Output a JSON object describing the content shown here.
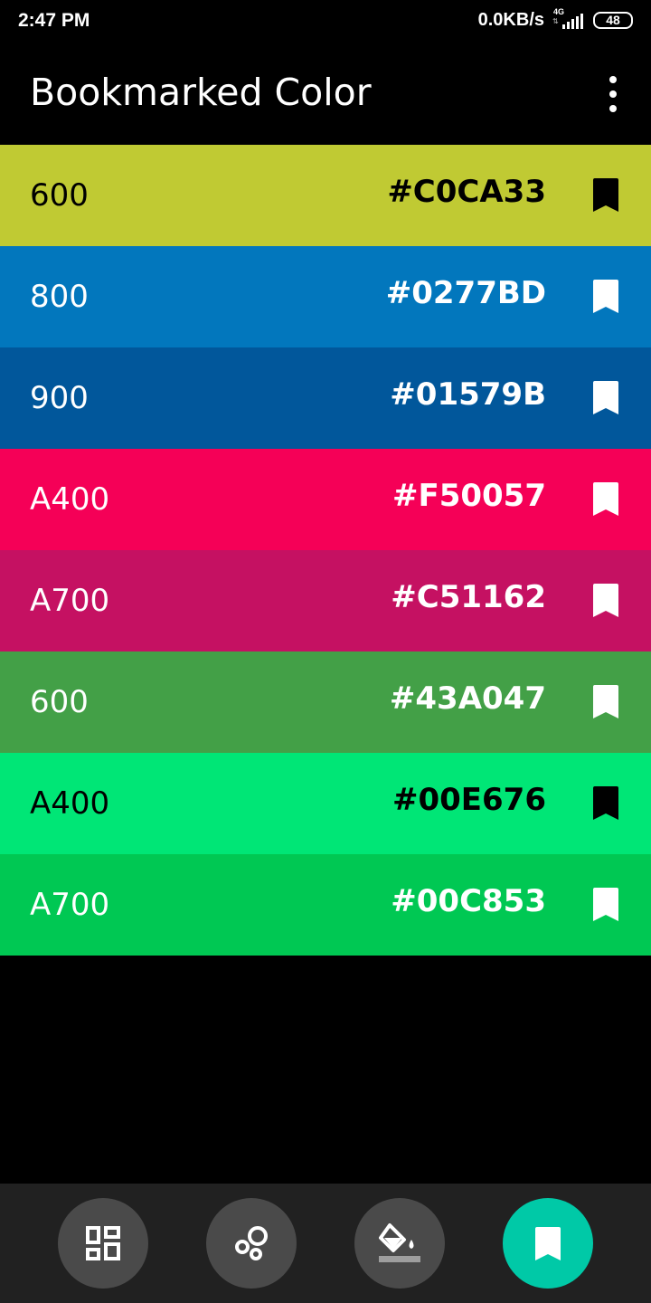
{
  "status_bar": {
    "time": "2:47 PM",
    "network_speed": "0.0KB/s",
    "network_type": "4G",
    "battery": "48"
  },
  "app_bar": {
    "title": "Bookmarked Color",
    "menu_icon": "more-vert-icon"
  },
  "colors": [
    {
      "shade": "600",
      "hex": "#C0CA33",
      "text_color": "#000000",
      "bookmark_color": "#000000"
    },
    {
      "shade": "800",
      "hex": "#0277BD",
      "text_color": "#ffffff",
      "bookmark_color": "#ffffff"
    },
    {
      "shade": "900",
      "hex": "#01579B",
      "text_color": "#ffffff",
      "bookmark_color": "#ffffff"
    },
    {
      "shade": "A400",
      "hex": "#F50057",
      "text_color": "#ffffff",
      "bookmark_color": "#ffffff"
    },
    {
      "shade": "A700",
      "hex": "#C51162",
      "text_color": "#ffffff",
      "bookmark_color": "#ffffff"
    },
    {
      "shade": "600",
      "hex": "#43A047",
      "text_color": "#ffffff",
      "bookmark_color": "#ffffff"
    },
    {
      "shade": "A400",
      "hex": "#00E676",
      "text_color": "#000000",
      "bookmark_color": "#000000"
    },
    {
      "shade": "A700",
      "hex": "#00C853",
      "text_color": "#ffffff",
      "bookmark_color": "#ffffff"
    }
  ],
  "bottom_nav": {
    "items": [
      {
        "icon": "dashboard-icon",
        "active": false
      },
      {
        "icon": "bubbles-icon",
        "active": false
      },
      {
        "icon": "paint-bucket-icon",
        "active": false
      },
      {
        "icon": "bookmark-icon",
        "active": true
      }
    ],
    "active_color": "#00C9A7"
  }
}
